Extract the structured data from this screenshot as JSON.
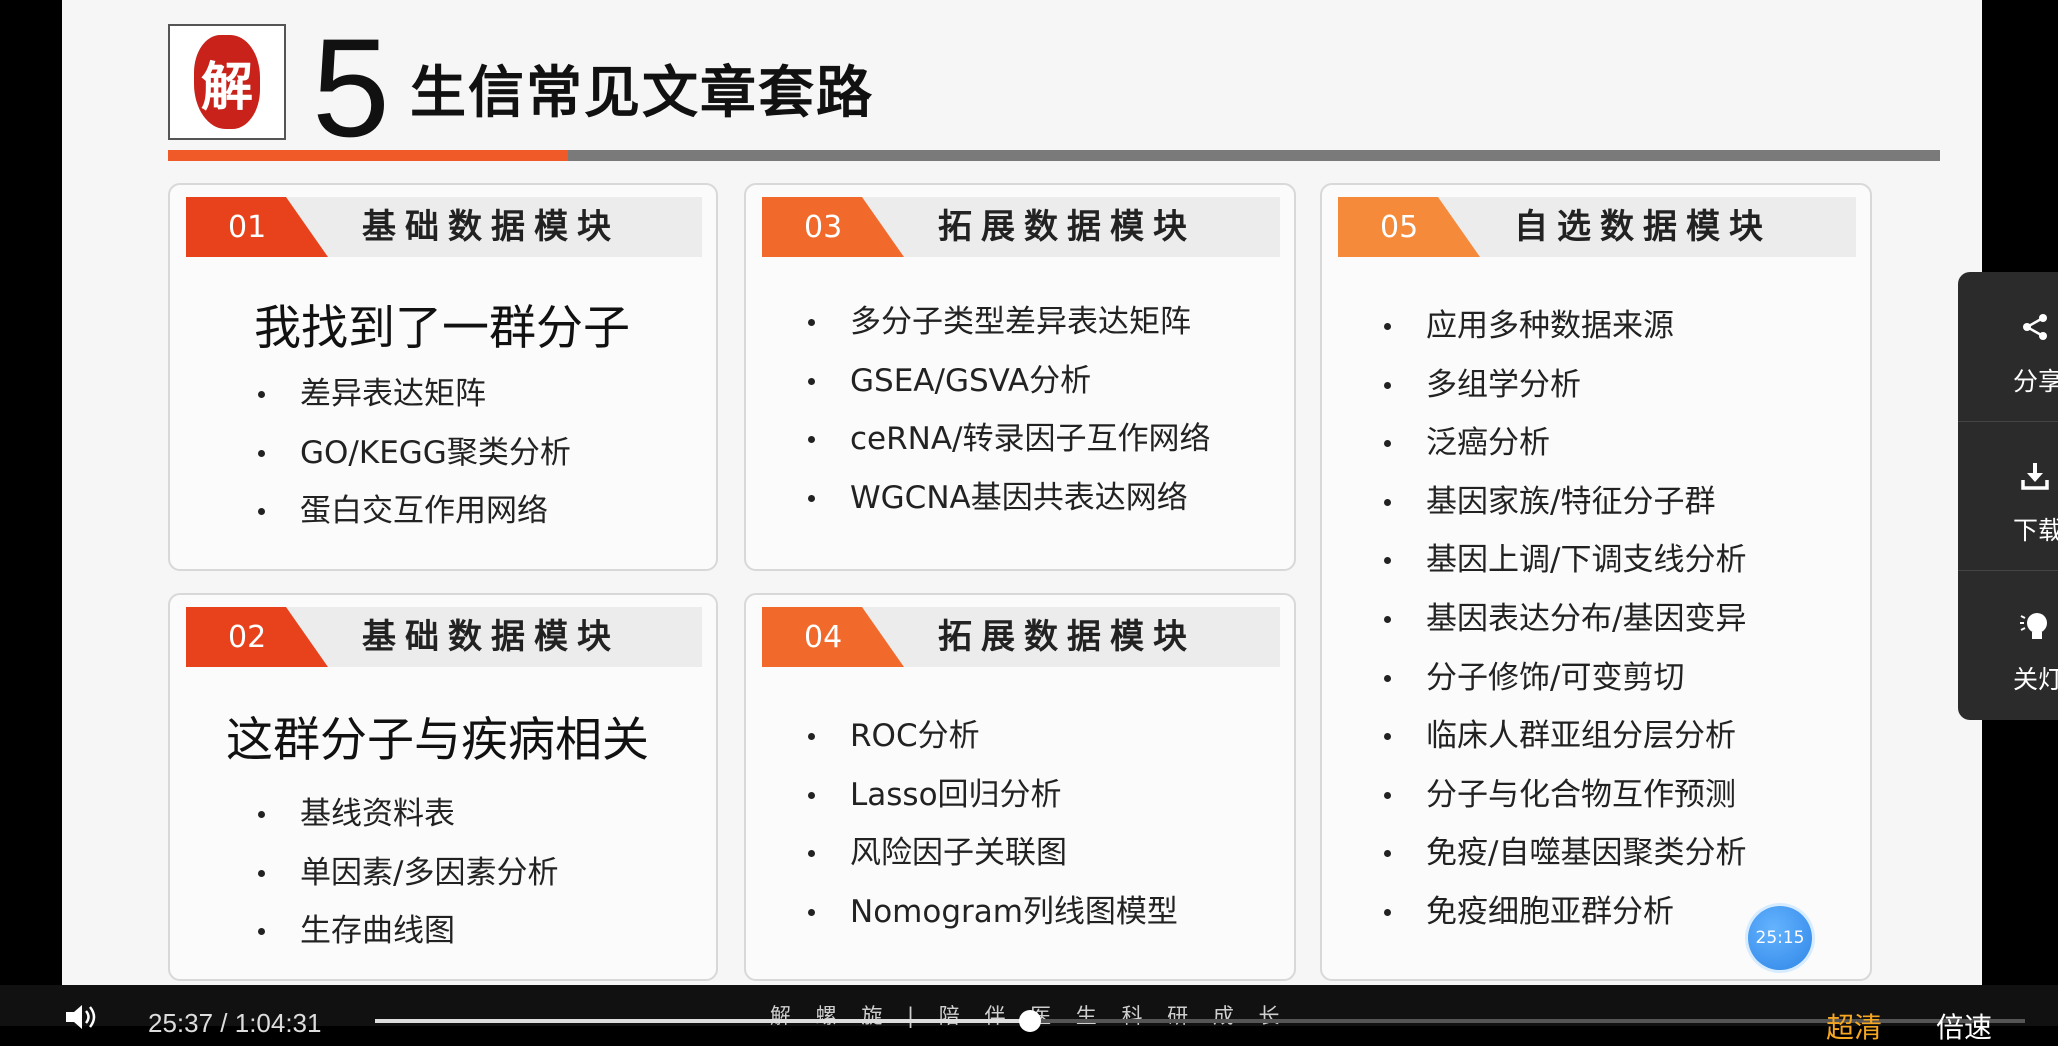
{
  "slide": {
    "section_number": "5",
    "section_title": "生信常见文章套路",
    "logo_char": "解",
    "watermark": "解 螺 旋  |  陪 伴 医 生 科 研 成 长",
    "timer_badge": "25:15",
    "cards": [
      {
        "badge": "01",
        "title": "基础数据模块",
        "subtitle": "我找到了一群分子",
        "items": [
          "差异表达矩阵",
          "GO/KEGG聚类分析",
          "蛋白交互作用网络"
        ]
      },
      {
        "badge": "02",
        "title": "基础数据模块",
        "subtitle": "这群分子与疾病相关",
        "items": [
          "基线资料表",
          "单因素/多因素分析",
          "生存曲线图"
        ]
      },
      {
        "badge": "03",
        "title": "拓展数据模块",
        "items": [
          "多分子类型差异表达矩阵",
          "GSEA/GSVA分析",
          "ceRNA/转录因子互作网络",
          "WGCNA基因共表达网络"
        ]
      },
      {
        "badge": "04",
        "title": "拓展数据模块",
        "items": [
          "ROC分析",
          "Lasso回归分析",
          "风险因子关联图",
          "Nomogram列线图模型"
        ]
      },
      {
        "badge": "05",
        "title": "自选数据模块",
        "items": [
          "应用多种数据来源",
          "多组学分析",
          "泛癌分析",
          "基因家族/特征分子群",
          "基因上调/下调支线分析",
          "基因表达分布/基因变异",
          "分子修饰/可变剪切",
          "临床人群亚组分层分析",
          "分子与化合物互作预测",
          "免疫/自噬基因聚类分析",
          "免疫细胞亚群分析"
        ]
      }
    ]
  },
  "side_panel": {
    "share": {
      "icon": "share-icon",
      "label": "分享"
    },
    "download": {
      "icon": "download-icon",
      "label": "下载"
    },
    "light": {
      "icon": "lightbulb-icon",
      "label": "关灯"
    }
  },
  "player": {
    "time": "25:37  /  1:04:31",
    "progress": 0.397,
    "quality": "超清",
    "speed": "倍速"
  },
  "colors": {
    "accent_red": "#e8421c",
    "accent_orange": "#f16a2c",
    "accent_light_orange": "#f58a3a",
    "header_gray": "#7a7a7a"
  }
}
